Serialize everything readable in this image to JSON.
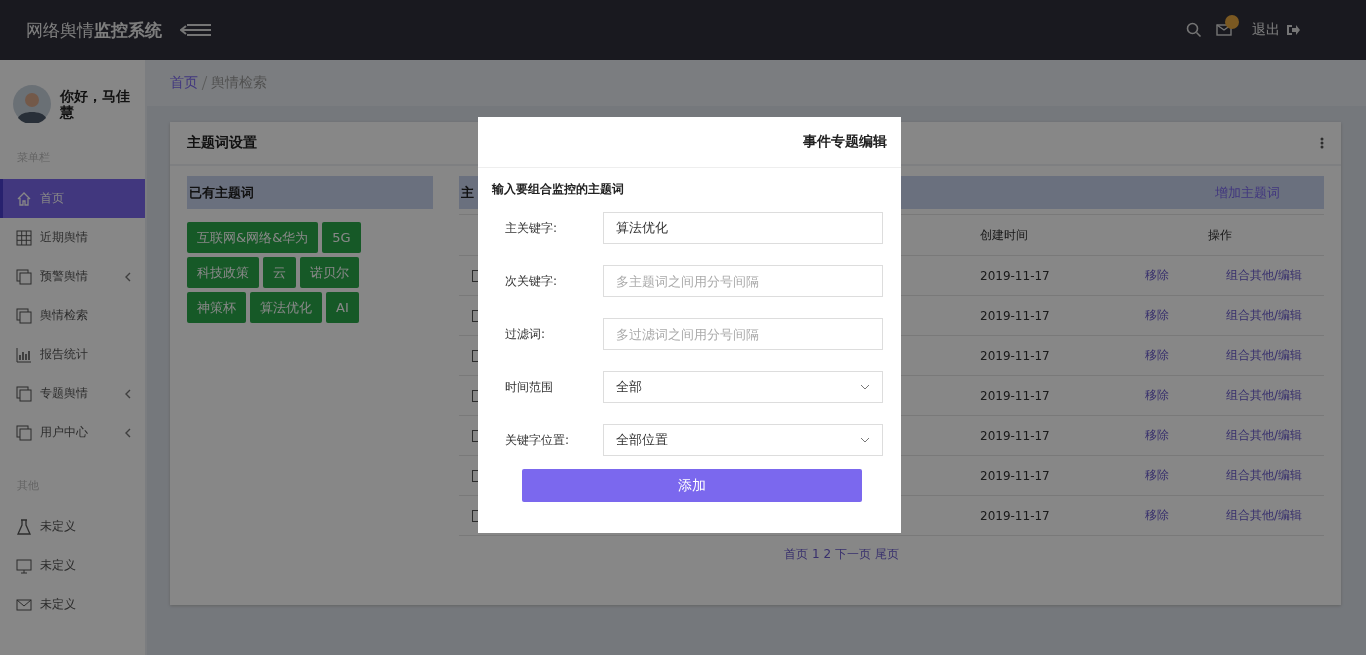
{
  "header": {
    "title": "网络舆情**监控系统**",
    "logout": "退出",
    "has_unread": true
  },
  "user": {
    "greeting": "你好，马佳慧"
  },
  "sidebar": {
    "sections": [
      {
        "label": "菜单栏",
        "items": [
          {
            "label": "首页",
            "selected": true,
            "expandable": false
          },
          {
            "label": "近期舆情",
            "selected": false,
            "expandable": false
          },
          {
            "label": "预警舆情",
            "selected": false,
            "expandable": true
          },
          {
            "label": "舆情检索",
            "selected": false,
            "expandable": false
          },
          {
            "label": "报告统计",
            "selected": false,
            "expandable": false
          },
          {
            "label": "专题舆情",
            "selected": false,
            "expandable": true
          },
          {
            "label": "用户中心",
            "selected": false,
            "expandable": true
          }
        ]
      },
      {
        "label": "其他",
        "items": [
          {
            "label": "未定义",
            "selected": false,
            "expandable": false
          },
          {
            "label": "未定义",
            "selected": false,
            "expandable": false
          },
          {
            "label": "未定义",
            "selected": false,
            "expandable": false
          }
        ]
      }
    ]
  },
  "breadcrumb": [
    "首页",
    "舆情检索"
  ],
  "card": {
    "title": "主题词设置",
    "existing": {
      "title": "已有主题词",
      "tags": [
        "互联网&网络&华为",
        "5G",
        "科技政策",
        "云",
        "诺贝尔",
        "神策杯",
        "算法优化",
        "AI"
      ]
    },
    "table_panel": {
      "title_fragment": "主",
      "add_link": "增加主题词",
      "columns": [
        "创建时间",
        "操作"
      ],
      "rows": [
        {
          "checked": false,
          "created": "2019-11-17",
          "actions": [
            "移除",
            "组合其他/编辑"
          ]
        },
        {
          "checked": false,
          "created": "2019-11-17",
          "actions": [
            "移除",
            "组合其他/编辑"
          ]
        },
        {
          "checked": false,
          "created": "2019-11-17",
          "actions": [
            "移除",
            "组合其他/编辑"
          ]
        },
        {
          "checked": false,
          "created": "2019-11-17",
          "actions": [
            "移除",
            "组合其他/编辑"
          ]
        },
        {
          "checked": false,
          "created": "2019-11-17",
          "actions": [
            "移除",
            "组合其他/编辑"
          ]
        },
        {
          "checked": false,
          "created": "2019-11-17",
          "actions": [
            "移除",
            "组合其他/编辑"
          ]
        },
        {
          "checked": false,
          "created": "2019-11-17",
          "actions": [
            "移除",
            "组合其他/编辑"
          ]
        }
      ],
      "pagination": "首页 1 2 下一页 尾页"
    }
  },
  "dialog": {
    "title": "事件专题编辑",
    "subtitle": "输入要组合监控的主题词",
    "fields": [
      {
        "kind": "text",
        "label": "主关键字:",
        "value": "算法优化"
      },
      {
        "kind": "text",
        "label": "次关键字:",
        "placeholder": "多主题词之间用分号间隔"
      },
      {
        "kind": "text",
        "label": "过滤词:",
        "placeholder": "多过滤词之间用分号间隔"
      },
      {
        "kind": "select",
        "label": "时间范围",
        "value": "全部"
      },
      {
        "kind": "select",
        "label": "关键字位置:",
        "value": "全部位置"
      }
    ],
    "submit": "添加"
  }
}
